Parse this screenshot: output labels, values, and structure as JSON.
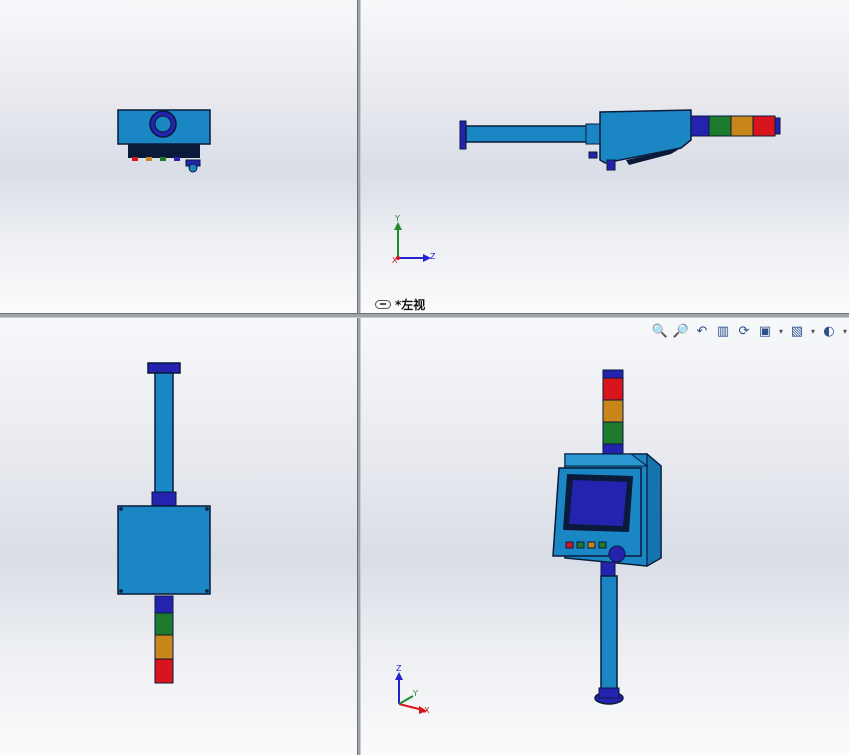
{
  "viewports": {
    "top_right": {
      "view_label": "*左视",
      "triad": {
        "up": "Y",
        "right": "Z",
        "origin": "X"
      }
    },
    "bottom_right": {
      "triad": {
        "up": "Z",
        "right": "X",
        "origin": "Y"
      }
    }
  },
  "toolbar": {
    "icons": [
      "zoom-to-fit-icon",
      "zoom-to-area-icon",
      "previous-view-icon",
      "section-view-icon",
      "dynamic-annotation-icon",
      "view-orientation-icon",
      "display-style-icon",
      "hide-show-items-icon"
    ]
  },
  "colors": {
    "housing_blue": "#1b86c4",
    "outline": "#0a1a3a",
    "flange_blue": "#1c1fb8",
    "lamp_red": "#d8141c",
    "lamp_amber": "#c8861a",
    "lamp_green": "#1e7a2c",
    "lamp_blue": "#2323b0"
  }
}
